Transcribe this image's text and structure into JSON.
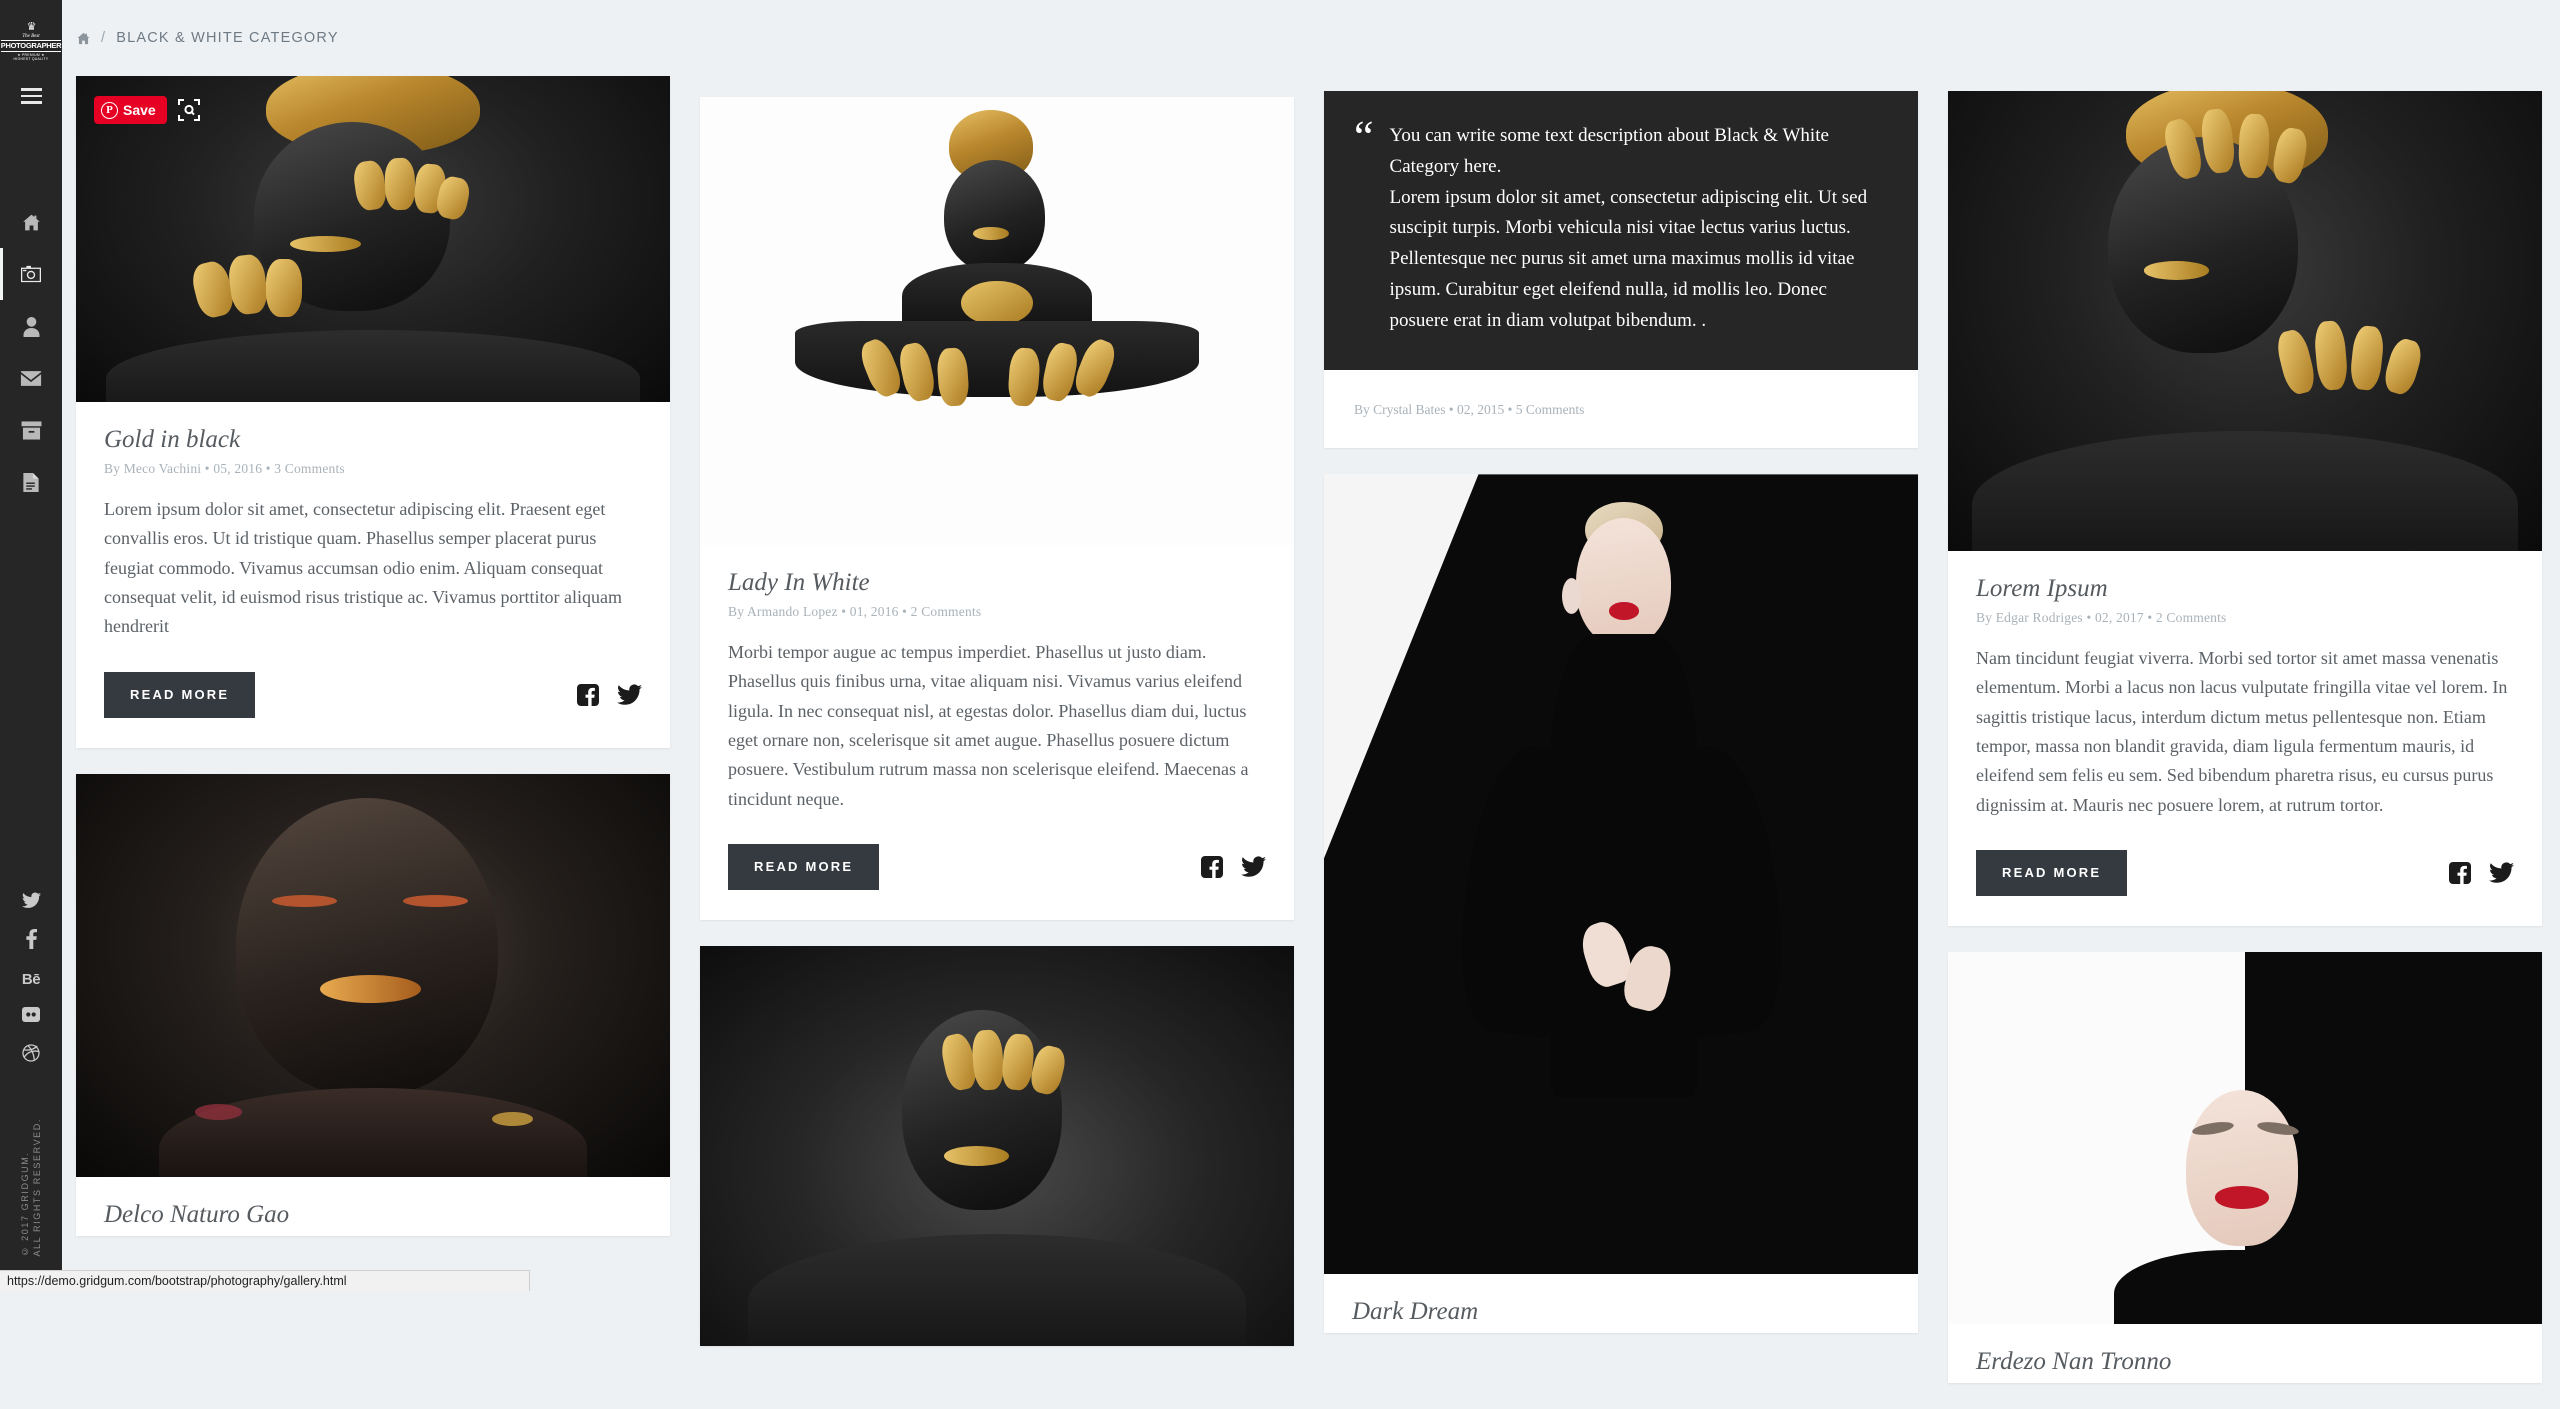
{
  "sidebar": {
    "logo": {
      "crown": "♛",
      "script": "The Best",
      "main": "PHOTOGRAPHER",
      "sub": "★ PREMIUM ★",
      "sub2": "HIGHEST QUALITY"
    },
    "menu_label": "Menu",
    "nav": [
      {
        "icon": "home-icon",
        "label": "Home"
      },
      {
        "icon": "camera-icon",
        "label": "Gallery"
      },
      {
        "icon": "user-icon",
        "label": "About"
      },
      {
        "icon": "envelope-icon",
        "label": "Contact"
      },
      {
        "icon": "archive-icon",
        "label": "Portfolio"
      },
      {
        "icon": "document-icon",
        "label": "Blog"
      }
    ],
    "social": [
      {
        "icon": "twitter-icon",
        "label": "Twitter"
      },
      {
        "icon": "facebook-icon",
        "label": "Facebook"
      },
      {
        "icon": "behance-icon",
        "label": "Bē"
      },
      {
        "icon": "flickr-icon",
        "label": "Flickr"
      },
      {
        "icon": "dribbble-icon",
        "label": "Dribbble"
      }
    ],
    "copyright_line1": "© 2017 GRIDGUM.",
    "copyright_line2": "ALL RIGHTS RESERVED."
  },
  "breadcrumb": {
    "home_icon": "home-icon",
    "separator": "/",
    "current": "BLACK & WHITE CATEGORY"
  },
  "pin": {
    "save_label": "Save",
    "logo_glyph": "P",
    "search_icon": "pinterest-search-icon"
  },
  "labels": {
    "read_more": "READ MORE",
    "facebook_icon": "facebook-icon",
    "twitter_icon": "twitter-icon"
  },
  "posts": [
    {
      "id": "gold-in-black",
      "title": "Gold in black",
      "meta": "By Meco Vachini • 05, 2016 • 3 Comments",
      "text": "Lorem ipsum dolor sit amet, consectetur adipiscing elit. Praesent eget convallis eros. Ut id tristique quam. Phasellus semper placerat purus feugiat commodo. Vivamus accumsan odio enim. Aliquam consequat consequat velit, id euismod risus tristique ac. Vivamus porttitor aliquam hendrerit"
    },
    {
      "id": "delco-naturo-gao",
      "title": "Delco Naturo Gao",
      "meta": "",
      "text": ""
    },
    {
      "id": "lady-in-white",
      "title": "Lady In White",
      "meta": "By Armando Lopez • 01, 2016 • 2 Comments",
      "text": "Morbi tempor augue ac tempus imperdiet. Phasellus ut justo diam. Phasellus quis finibus urna, vitae aliquam nisi. Vivamus varius eleifend ligula. In nec consequat nisl, at egestas dolor. Phasellus diam dui, luctus eget ornare non, scelerisque sit amet augue. Phasellus posuere dictum posuere. Vestibulum rutrum massa non scelerisque eleifend. Maecenas a tincidunt neque."
    },
    {
      "id": "quote-post",
      "title": "",
      "meta": "By Crystal Bates • 02, 2015 • 5 Comments",
      "quote": "You can write some text description about Black & White Category here.\nLorem ipsum dolor sit amet, consectetur adipiscing elit. Ut sed suscipit turpis. Morbi vehicula nisi vitae lectus varius luctus. Pellentesque nec purus sit amet urna maximus mollis id vitae ipsum. Curabitur eget eleifend nulla, id mollis leo. Donec posuere erat in diam volutpat bibendum. .",
      "quote_mark": "“"
    },
    {
      "id": "dark-dream",
      "title": "Dark Dream",
      "meta": "",
      "text": ""
    },
    {
      "id": "lorem-ipsum",
      "title": "Lorem Ipsum",
      "meta": "By Edgar Rodriges • 02, 2017 • 2 Comments",
      "text": "Nam tincidunt feugiat viverra. Morbi sed tortor sit amet massa venenatis elementum. Morbi a lacus non lacus vulputate fringilla vitae vel lorem. In sagittis tristique lacus, interdum dictum metus pellentesque non. Etiam tempor, massa non blandit gravida, diam ligula fermentum mauris, id eleifend sem felis eu sem. Sed bibendum pharetra risus, eu cursus purus dignissim at. Mauris nec posuere lorem, at rutrum tortor."
    },
    {
      "id": "erdezo-nan-tronno",
      "title": "Erdezo Nan Tronno",
      "meta": "",
      "text": ""
    }
  ],
  "status_bar": {
    "url": "https://demo.gridgum.com/bootstrap/photography/gallery.html"
  },
  "colors": {
    "sidebar_bg": "#262626",
    "page_bg": "#eef1f3",
    "card_bg": "#ffffff",
    "button_bg": "#343a40",
    "pinterest_red": "#e60023",
    "meta_text": "#a9b2b9",
    "body_text": "#5b6166",
    "title_text": "#565b60"
  }
}
